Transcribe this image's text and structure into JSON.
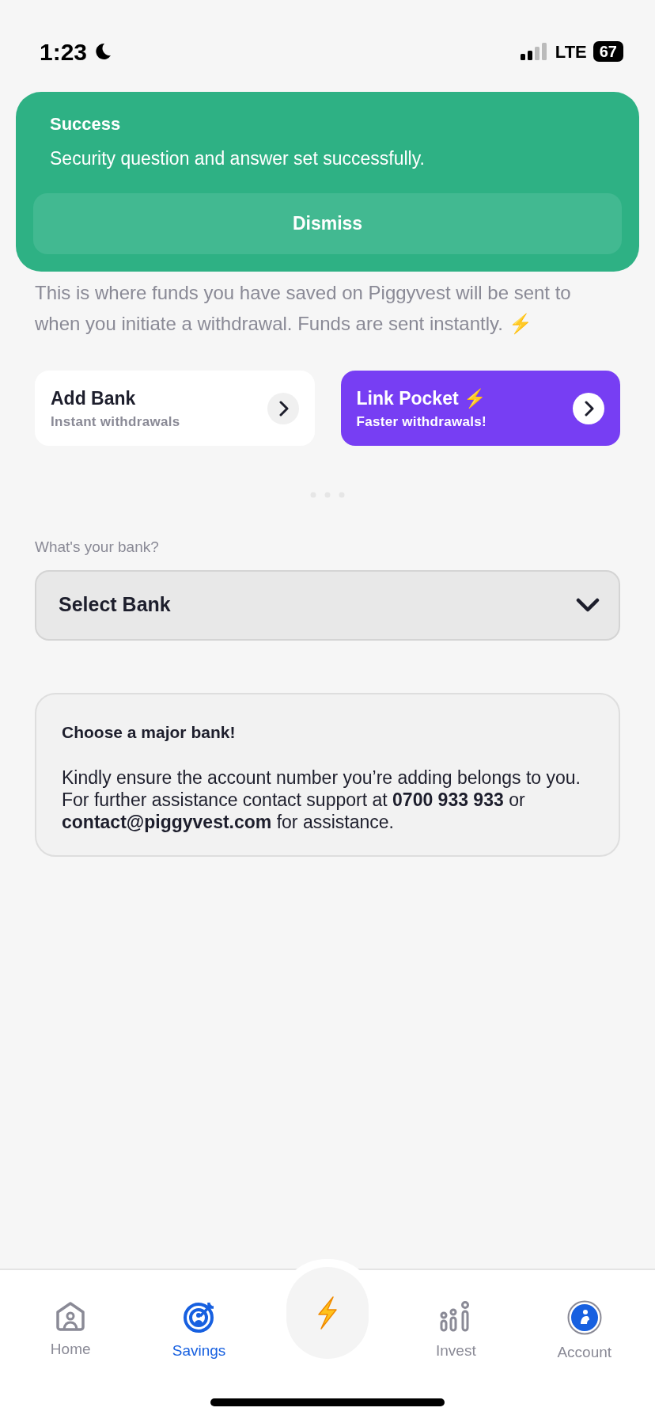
{
  "status_bar": {
    "time": "1:23",
    "network": "LTE",
    "battery": "67"
  },
  "toast": {
    "title": "Success",
    "message": "Security question and answer set successfully.",
    "button": "Dismiss"
  },
  "description": "This is where funds you have saved on Piggyvest will be sent to when you initiate a withdrawal. Funds are sent instantly. ⚡",
  "options": [
    {
      "kind": "plain",
      "title": "Add Bank",
      "subtitle": "Instant withdrawals"
    },
    {
      "kind": "featured",
      "title": "Link Pocket ⚡",
      "subtitle": "Faster withdrawals!"
    }
  ],
  "bank_field": {
    "label": "What's your bank?",
    "placeholder": "Select Bank"
  },
  "info": {
    "title": "Choose a major bank!",
    "body": "Kindly ensure the account number you’re adding belongs to you. For further assistance contact support at **0700 933 933** or **contact@piggyvest.com** for assistance."
  },
  "tabs": [
    {
      "kind": "home",
      "label": "Home",
      "selected": false
    },
    {
      "kind": "savings",
      "label": "Savings",
      "selected": true
    },
    {
      "kind": "action",
      "selected": false
    },
    {
      "kind": "invest",
      "label": "Invest",
      "selected": false
    },
    {
      "kind": "account",
      "label": "Account",
      "selected": false
    }
  ]
}
